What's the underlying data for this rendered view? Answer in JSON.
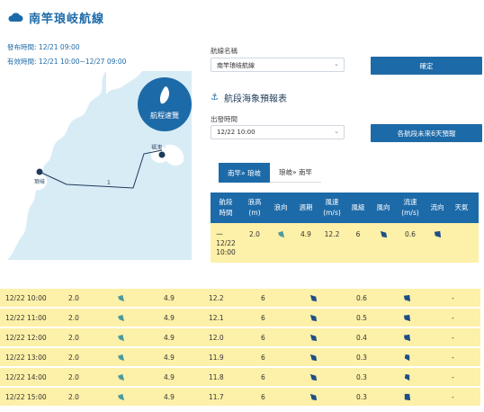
{
  "header": {
    "title": "南竿琅岐航線"
  },
  "meta": {
    "publish_label": "發布時間:",
    "publish_value": "12/21 09:00",
    "valid_label": "有效時間:",
    "valid_value": "12/21 10:00~12/27 09:00"
  },
  "map": {
    "button_label": "航程速覽",
    "labels": {
      "langqi": "琅岐",
      "nangan": "福澳",
      "route_no": "1"
    },
    "markers": {
      "start": "2",
      "end": "1"
    }
  },
  "form": {
    "route_label": "航線名稱",
    "route_value": "南竿琅岐航線",
    "confirm_label": "確定",
    "section_title": "航段海象預報表",
    "depart_label": "出發時間",
    "depart_value": "12/22 10:00",
    "forecast_btn": "各航段未來6天預報"
  },
  "tabs": [
    {
      "label": "南竿» 琅岐",
      "active": true
    },
    {
      "label": "琅岐» 南竿",
      "active": false
    }
  ],
  "table": {
    "headers": [
      "航段\n時間",
      "浪高\n(m)",
      "浪向",
      "週期",
      "風速\n(m/s)",
      "風級",
      "風向",
      "流速\n(m/s)",
      "流向",
      "天氣"
    ],
    "first_row": {
      "time": "一\n12/22\n10:00",
      "wave": "2.0",
      "period": "4.9",
      "wind": "12.2",
      "level": "6",
      "current": "0.6",
      "weather": ""
    }
  },
  "rows": [
    {
      "time": "12/22 10:00",
      "wave": "2.0",
      "period": "4.9",
      "wind": "12.2",
      "level": "6",
      "current": "0.6",
      "weather": "-"
    },
    {
      "time": "12/22 11:00",
      "wave": "2.0",
      "period": "4.9",
      "wind": "12.1",
      "level": "6",
      "current": "0.5",
      "weather": "-"
    },
    {
      "time": "12/22 12:00",
      "wave": "2.0",
      "period": "4.9",
      "wind": "12.0",
      "level": "6",
      "current": "0.4",
      "weather": "-"
    },
    {
      "time": "12/22 13:00",
      "wave": "2.0",
      "period": "4.9",
      "wind": "11.9",
      "level": "6",
      "current": "0.3",
      "weather": "-"
    },
    {
      "time": "12/22 14:00",
      "wave": "2.0",
      "period": "4.9",
      "wind": "11.8",
      "level": "6",
      "current": "0.3",
      "weather": "-"
    },
    {
      "time": "12/22 15:00",
      "wave": "2.0",
      "period": "4.9",
      "wind": "11.7",
      "level": "6",
      "current": "0.3",
      "weather": "-"
    }
  ]
}
